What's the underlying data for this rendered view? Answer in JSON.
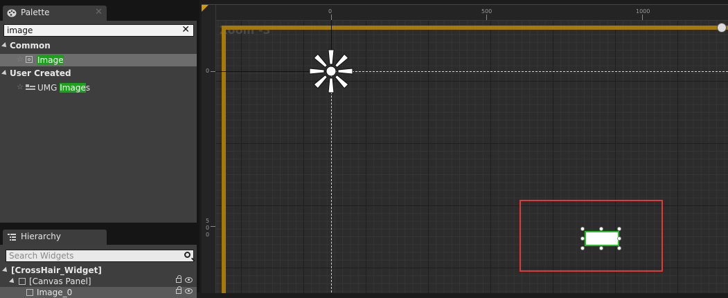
{
  "palette": {
    "tab_label": "Palette",
    "search_value": "image",
    "categories": [
      {
        "label": "Common",
        "items": [
          {
            "pre": "",
            "hl": "Image",
            "post": "",
            "selected": true
          }
        ]
      },
      {
        "label": "User Created",
        "items": [
          {
            "pre": "UMG ",
            "hl": "Image",
            "post": "s",
            "selected": false
          }
        ]
      }
    ]
  },
  "hierarchy": {
    "tab_label": "Hierarchy",
    "search_placeholder": "Search Widgets",
    "tree": [
      {
        "label": "[CrossHair_Widget]"
      },
      {
        "label": "[Canvas Panel]"
      },
      {
        "label": "Image_0"
      }
    ]
  },
  "designer": {
    "zoom_label": "Zoom -3",
    "ruler_top": [
      "0",
      "500",
      "1000"
    ],
    "ruler_left": [
      "0",
      "5",
      "0",
      "0"
    ]
  },
  "colors": {
    "accent_orange": "#a67a08",
    "highlight_green": "#19a319",
    "selection_green": "#21c021",
    "annotation_red": "#e03a3a"
  }
}
